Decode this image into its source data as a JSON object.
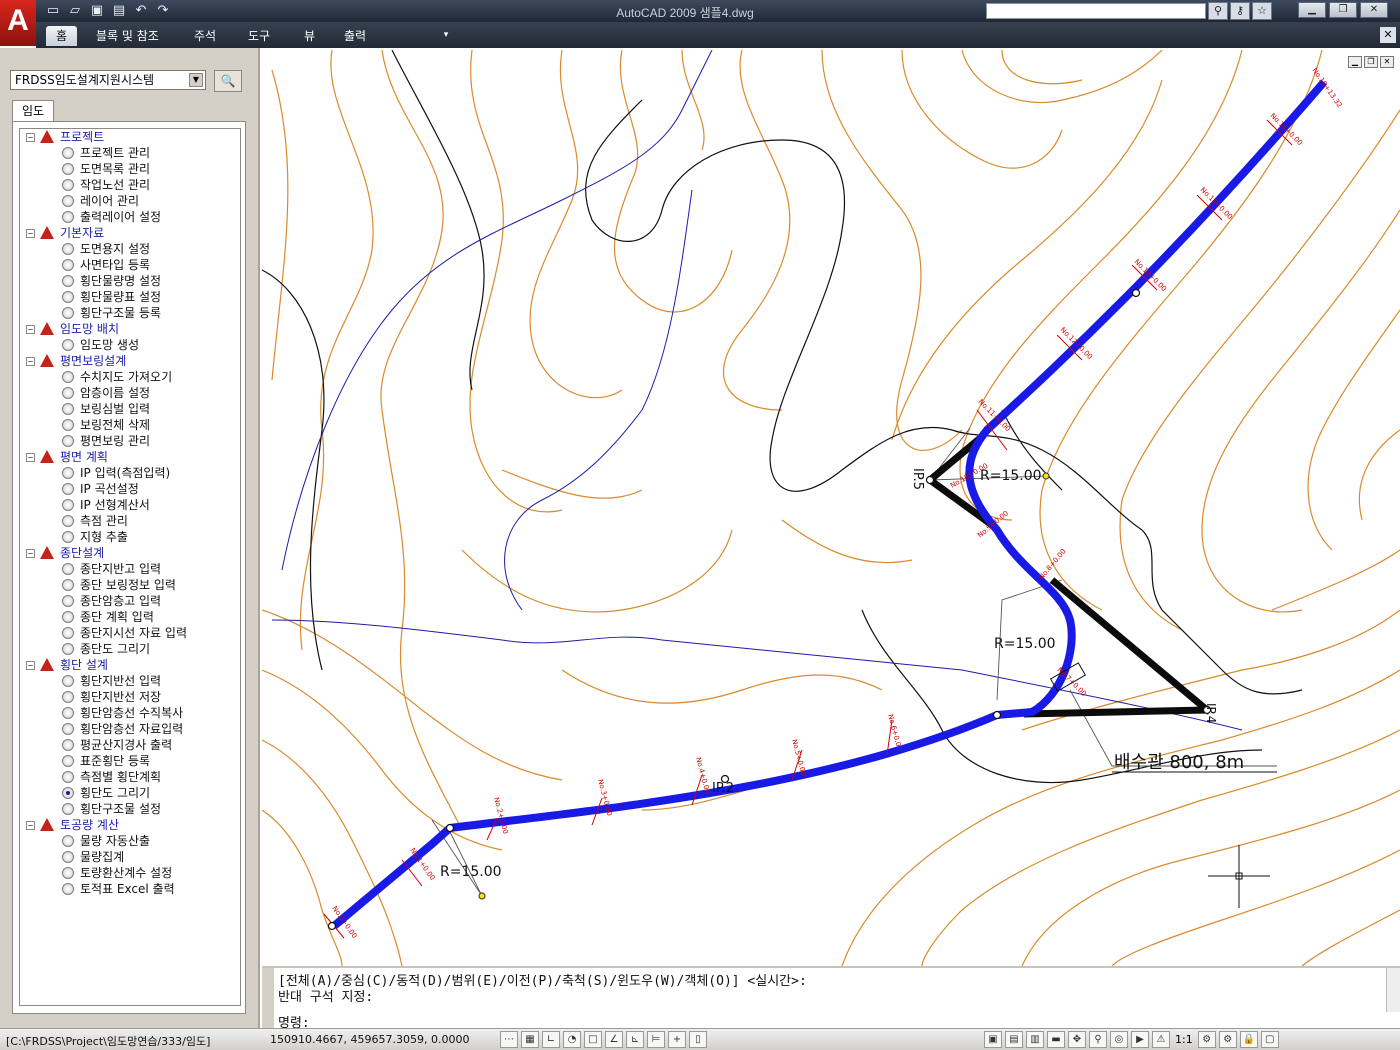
{
  "window": {
    "title": "AutoCAD 2009 샘플4.dwg",
    "logo": "A",
    "quick_access_icons": [
      "new-icon",
      "open-icon",
      "save-icon",
      "print-icon",
      "undo-icon",
      "redo-icon"
    ],
    "search_tools": [
      "search-icon",
      "key-icon",
      "star-icon"
    ],
    "controls": [
      "minimize-icon",
      "restore-icon",
      "close-icon"
    ]
  },
  "ribbon": {
    "tabs": [
      "홈",
      "블록 및 참조",
      "주석",
      "도구",
      "뷰",
      "출력"
    ],
    "active_tab": 0
  },
  "panel": {
    "system_select": "FRDSS임도설계지원시스템",
    "tab_label": "임도",
    "groups": [
      {
        "label": "프로젝트",
        "items": [
          "프로젝트 관리",
          "도면목록 관리",
          "작업노선 관리",
          "레이어 관리",
          "출력레이어 설정"
        ]
      },
      {
        "label": "기본자료",
        "items": [
          "도면용지 설정",
          "사면타입 등록",
          "횡단물량명 설정",
          "횡단물량표 설정",
          "횡단구조물 등록"
        ]
      },
      {
        "label": "임도망 배치",
        "items": [
          "임도망 생성"
        ]
      },
      {
        "label": "평면보링설계",
        "items": [
          "수치지도 가져오기",
          "암층이름 설정",
          "보링심벌 입력",
          "보링전체 삭제",
          "평면보링 관리"
        ]
      },
      {
        "label": "평면 계획",
        "items": [
          "IP 입력(측점입력)",
          "IP 곡선설정",
          "IP 선형계산서",
          "측점 관리",
          "지형 추출"
        ]
      },
      {
        "label": "종단설계",
        "items": [
          "종단지반고 입력",
          "종단 보링정보 입력",
          "종단암층고 입력",
          "종단 계획 입력",
          "종단지시선 자료 입력",
          "종단도 그리기"
        ]
      },
      {
        "label": "횡단 설계",
        "items": [
          "횡단지반선 입력",
          "횡단지반선 저장",
          "횡단암층선 수직복사",
          "횡단암층선 자료입력",
          "평균산지경사 출력",
          "표준횡단 등록",
          "측점별 횡단계획",
          "횡단도 그리기",
          "횡단구조물 설정"
        ]
      },
      {
        "label": "토공량 계산",
        "items": [
          "물량 자동산출",
          "물량집계",
          "토량환산계수 설정",
          "토적표 Excel 출력"
        ]
      }
    ],
    "selected_item": "횡단도 그리기"
  },
  "drawing": {
    "annotations": {
      "ip5": "IP.5",
      "ip4": "IP.4",
      "ip2": "IP.2",
      "r_top": "R=15.00",
      "r_mid": "R=15.00",
      "r_bottom": "R=15.00",
      "culvert": "배수관 800, 8m"
    },
    "station_labels": [
      "No.0+0.00",
      "No.1+0.00",
      "No.2+0.00",
      "No.3+0.00",
      "No.4+0.00",
      "No.5+0.00",
      "No.6+0.00",
      "No.7+0.00",
      "No.8+0.00",
      "No.9+0.00",
      "No.10+0.00",
      "No.11+0.00",
      "No.12+0.00",
      "No.13+0.00",
      "No.14+0.00",
      "No.15+0.00",
      "No.16+0.00",
      "No.17+0.00",
      "No.18+0.00",
      "No.19+13.32"
    ],
    "colors": {
      "route": "#1a1ae6",
      "contour": "#d98a2c",
      "boundary": "#1c1ca8",
      "station": "#d00000"
    }
  },
  "command": {
    "line1": "[전체(A)/중심(C)/동적(D)/범위(E)/이전(P)/축척(S)/윈도우(W)/객체(O)] <실시간>:",
    "line2": "반대 구석 지정:",
    "prompt": "명령:"
  },
  "status": {
    "path": "[C:\\FRDSS\\Project\\임도망연습/333/임도]",
    "coords": "150910.4667, 459657.3059, 0.0000",
    "scale": "1:1"
  }
}
